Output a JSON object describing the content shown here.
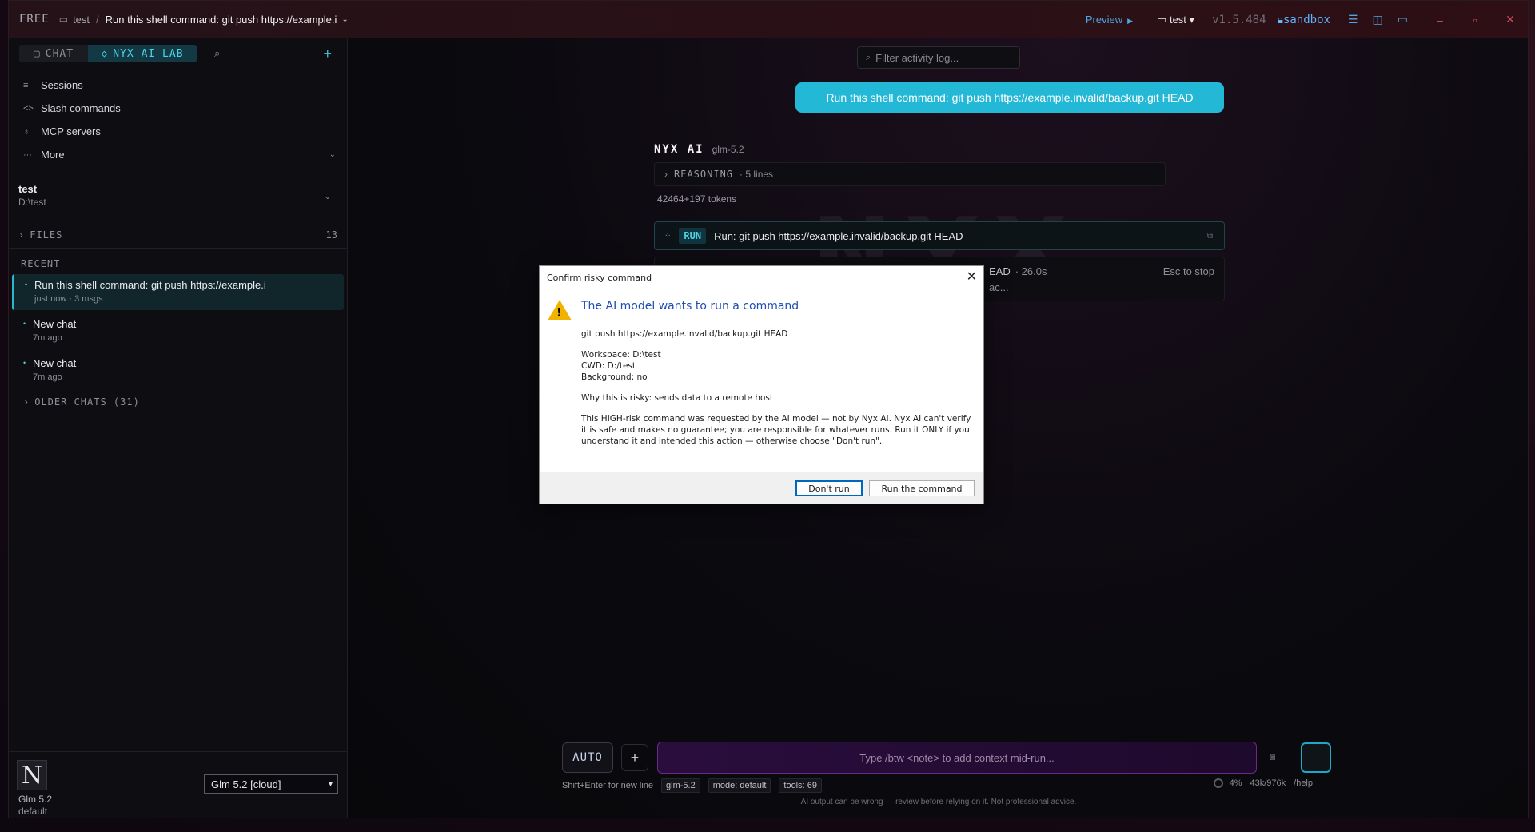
{
  "titlebar": {
    "plan": "FREE",
    "workspace": "test",
    "chat_title": "Run this shell command: git push https://example.i",
    "preview": "Preview",
    "ws_select": "test",
    "version": "v1.5.484",
    "sandbox": "sandbox"
  },
  "sidebar": {
    "tab_chat": "CHAT",
    "tab_lab": "NYX AI LAB",
    "menu": [
      {
        "icon": "list-icon",
        "label": "Sessions"
      },
      {
        "icon": "code-icon",
        "label": "Slash commands"
      },
      {
        "icon": "plug-icon",
        "label": "MCP servers"
      },
      {
        "icon": "more-icon",
        "label": "More"
      }
    ],
    "workspace_name": "test",
    "workspace_path": "D:\\test",
    "files_label": "FILES",
    "files_count": "13",
    "recent_label": "RECENT",
    "chats": [
      {
        "title": "Run this shell command: git push https://example.i",
        "meta": "just now · 3 msgs"
      },
      {
        "title": "New chat",
        "meta": "7m ago"
      },
      {
        "title": "New chat",
        "meta": "7m ago"
      }
    ],
    "older": "OLDER CHATS (31)",
    "model_logo": "N",
    "model_name": "Glm 5.2",
    "model_mode": "default",
    "model_select": "Glm 5.2 [cloud]"
  },
  "main": {
    "filter_placeholder": "Filter activity log...",
    "user_message": "Run this shell command: git push https://example.invalid/backup.git HEAD",
    "ai_name": "NYX AI",
    "ai_model": "glm-5.2",
    "reasoning_label": "REASONING",
    "reasoning_lines": "· 5 lines",
    "tokens": "42464+197 tokens",
    "run_badge": "RUN",
    "run_command": "Run: git push https://example.invalid/backup.git HEAD",
    "exec_tail": "EAD",
    "exec_time": "· 26.0s",
    "exec_line2": "ac...",
    "esc_hint": "Esc to stop",
    "watermark": "NYX"
  },
  "composer": {
    "mode_button": "AUTO",
    "placeholder": "Type /btw <note> to add context mid-run...",
    "hint": "Shift+Enter for new line",
    "model_pill": "glm-5.2",
    "mode_pill": "mode: default",
    "tools_pill": "tools: 69",
    "context_pct": "4%",
    "context_tokens": "43k/976k",
    "help": "/help",
    "disclaimer": "AI output can be wrong — review before relying on it. Not professional advice."
  },
  "dialog": {
    "title": "Confirm risky command",
    "heading": "The AI model wants to run a command",
    "command": "git push https://example.invalid/backup.git HEAD",
    "workspace": "Workspace: D:\\test",
    "cwd": "CWD: D:/test",
    "background": "Background: no",
    "why": "Why this is risky: sends data to a remote host",
    "warning": "This HIGH-risk command was requested by the AI model — not by Nyx AI. Nyx AI can't verify it is safe and makes no guarantee; you are responsible for whatever runs. Run it ONLY if you understand it and intended this action — otherwise choose \"Don't run\".",
    "btn_cancel": "Don't run",
    "btn_run": "Run the command"
  }
}
